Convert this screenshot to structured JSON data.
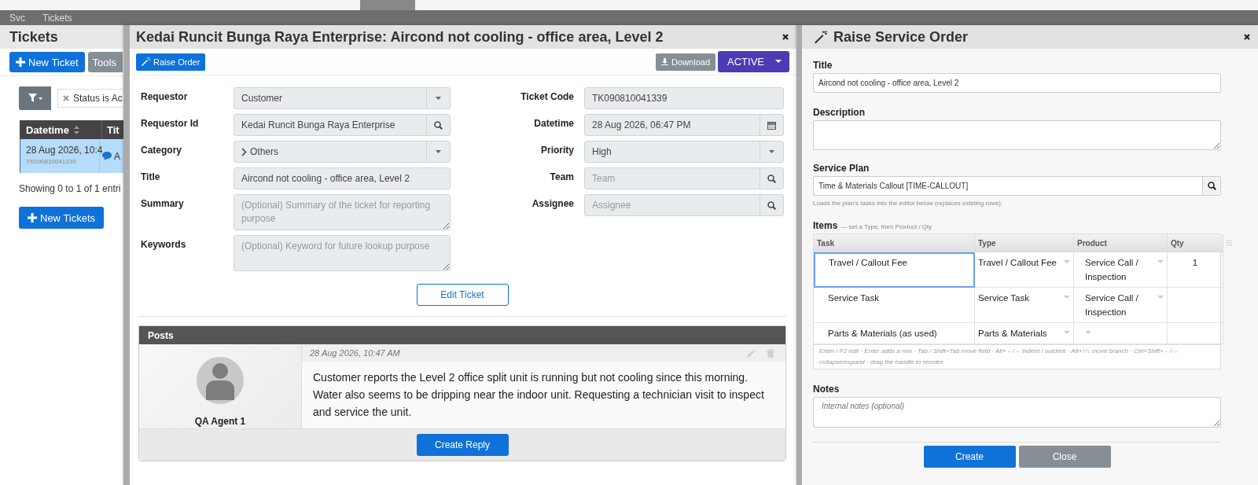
{
  "breadcrumb": [
    "Svc",
    "Tickets"
  ],
  "page": {
    "title": "Tickets",
    "new_ticket": "New Ticket",
    "tools": "Tools",
    "filter_chip": "Status is Ac",
    "columns": [
      "Datetime",
      "Tit"
    ],
    "rows": [
      {
        "datetime": "28 Aug 2026, 10:4",
        "code": "TK090810041339",
        "title": "A",
        "selected": true
      }
    ],
    "info": "Showing 0 to 1 of 1 entri",
    "new_tickets": "New Tickets"
  },
  "ticket": {
    "title": "Kedai Runcit Bunga Raya Enterprise: Aircond not cooling - office area, Level 2",
    "raise_order": "Raise Order",
    "download": "Download",
    "status": "ACTIVE",
    "left_fields": [
      {
        "label": "Requestor",
        "value": "Customer",
        "kind": "select"
      },
      {
        "label": "Requestor Id",
        "value": "Kedai Runcit Bunga Raya Enterprise",
        "kind": "lookup"
      },
      {
        "label": "Category",
        "value": "Others",
        "kind": "tree"
      },
      {
        "label": "Title",
        "value": "Aircond not cooling - office area, Level 2",
        "kind": "text"
      },
      {
        "label": "Summary",
        "placeholder": "(Optional) Summary of the ticket for reporting purpose",
        "kind": "textarea"
      },
      {
        "label": "Keywords",
        "placeholder": "(Optional) Keyword for future lookup purpose",
        "kind": "textarea"
      }
    ],
    "right_fields": [
      {
        "label": "Ticket Code",
        "value": "TK090810041339",
        "kind": "text"
      },
      {
        "label": "Datetime",
        "value": "28 Aug 2026, 06:47 PM",
        "kind": "date"
      },
      {
        "label": "Priority",
        "value": "High",
        "kind": "select"
      },
      {
        "label": "Team",
        "placeholder": "Team",
        "kind": "lookup"
      },
      {
        "label": "Assignee",
        "placeholder": "Assignee",
        "kind": "lookup"
      }
    ],
    "edit_ticket": "Edit Ticket",
    "posts": {
      "title": "Posts",
      "items": [
        {
          "author": "QA Agent 1",
          "time": "28 Aug 2026, 10:47 AM",
          "text": "Customer reports the Level 2 office split unit is running but not cooling since this morning. Water also seems to be dripping near the indoor unit. Requesting a technician visit to inspect and service the unit."
        }
      ],
      "create_reply": "Create Reply"
    }
  },
  "order": {
    "title": "Raise Service Order",
    "title_label": "Title",
    "title_value": "Aircond not cooling - office area, Level 2",
    "description_label": "Description",
    "plan_label": "Service Plan",
    "plan_value": "Time & Materials Callout [TIME-CALLOUT]",
    "plan_hint": "Loads the plan's tasks into the editor below (replaces existing rows).",
    "items_label": "Items",
    "items_hint": "— set a Type, then Product / Qty",
    "columns": [
      "Task",
      "Type",
      "Product",
      "Qty"
    ],
    "rows": [
      {
        "task": "Travel / Callout Fee",
        "type": "Travel / Callout Fee",
        "product": "Service Call / Inspection",
        "qty": "1",
        "focused": true
      },
      {
        "task": "Service Task",
        "type": "Service Task",
        "product": "Service Call / Inspection",
        "focused": false
      },
      {
        "task": "Parts & Materials (as used)",
        "type": "Parts & Materials",
        "focused": false
      }
    ],
    "keys_hint": "Enter / F2 edit · Enter adds a row · Tab / Shift+Tab move field · Alt+←/→ indent / outdent · Alt+↑/↓ move branch · Ctrl+Shift+←/→ collapse/expand · drag the handle to reorder.",
    "notes_label": "Notes",
    "notes_placeholder": "Internal notes (optional)",
    "create": "Create",
    "close": "Close"
  }
}
